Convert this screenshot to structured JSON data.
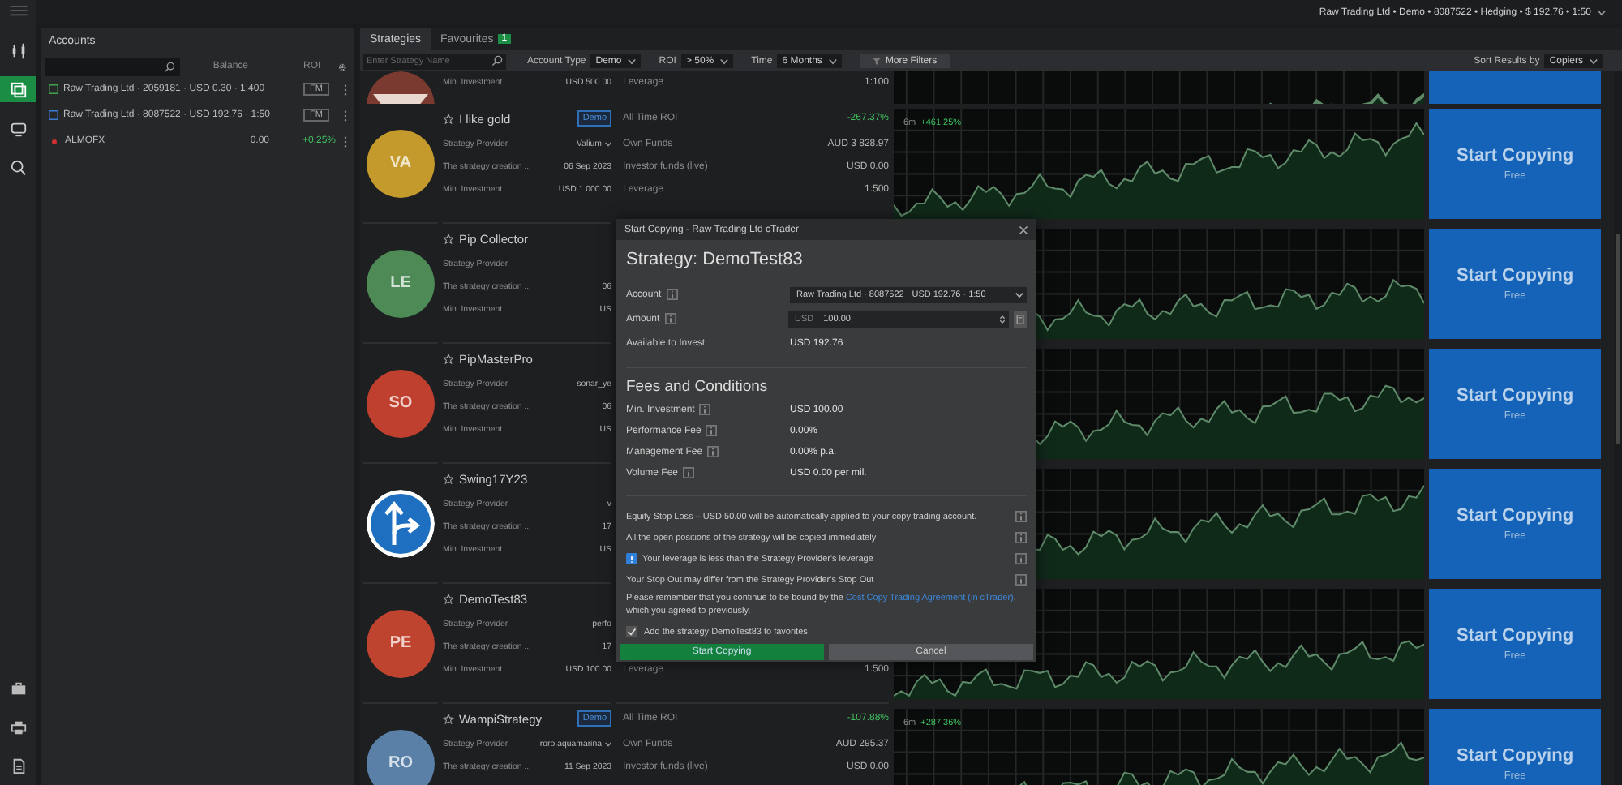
{
  "top_bar": {
    "account": "Raw Trading Ltd • Demo • 8087522 • Hedging • $ 192.76 • 1:50"
  },
  "rail": [
    {
      "kind": "trade",
      "selected": false
    },
    {
      "kind": "copy",
      "selected": true
    },
    {
      "kind": "monitor",
      "selected": false
    },
    {
      "kind": "analyze",
      "selected": false
    }
  ],
  "rail_bottom": [
    {
      "kind": "briefcase",
      "selected": false
    },
    {
      "kind": "printer",
      "selected": false
    },
    {
      "kind": "document",
      "selected": false
    }
  ],
  "accounts": {
    "title": "Accounts",
    "columns": [
      "Balance",
      "ROI"
    ],
    "rows": [
      {
        "kind": "ctrader",
        "color": "#3fa34d",
        "label": "Raw Trading Ltd · 2059181 · USD 0.30 · 1:400",
        "badge": "FM"
      },
      {
        "kind": "ctrader",
        "color": "#3a7bd5",
        "label": "Raw Trading Ltd · 8087522 · USD 192.76 · 1:50",
        "badge": "FM"
      },
      {
        "kind": "broker",
        "color": "#d03030",
        "label": "ALMOFX",
        "balance": "0.00",
        "roi": "+0.25%"
      }
    ]
  },
  "tabs": [
    {
      "label": "Strategies",
      "selected": true
    },
    {
      "label": "Favourites",
      "count": "1",
      "selected": false
    }
  ],
  "filters": {
    "search_placeholder": "Enter Strategy Name",
    "selects": [
      {
        "label": "Account Type",
        "value": "Demo"
      },
      {
        "label": "ROI",
        "value": "> 50%"
      },
      {
        "label": "Time",
        "value": "6 Months"
      }
    ],
    "more": "More Filters",
    "sort": {
      "label": "Sort Results by",
      "value": "Copiers"
    }
  },
  "strategies": [
    {
      "kind": "partial",
      "avatar": {
        "kind": "picture"
      },
      "min_label": "Min. Investment",
      "min": "USD 500.00",
      "stats": [
        {
          "kind": "leverage",
          "label": "Leverage",
          "value": "1:100"
        }
      ]
    },
    {
      "kind": "full",
      "name": "I like gold",
      "demo": "Demo",
      "avatar": {
        "kind": "initials",
        "initials": "VA",
        "color": "#c49a2c"
      },
      "provider_label": "Strategy Provider",
      "provider": "Valium",
      "created_label": "The strategy creation ...",
      "created": "06 Sep 2023",
      "min_label": "Min. Investment",
      "min": "USD 1 000.00",
      "stats": [
        {
          "kind": "roi",
          "label": "All Time ROI",
          "value": "-267.37%"
        },
        {
          "kind": "funds",
          "label": "Own Funds",
          "value": "AUD 3 828.97"
        },
        {
          "kind": "investor",
          "label": "Investor funds (live)",
          "value": "USD 0.00"
        },
        {
          "kind": "leverage",
          "label": "Leverage",
          "value": "1:500"
        }
      ],
      "chart_label": {
        "period": "6m",
        "value": "+461.25%"
      },
      "button": {
        "label": "Start Copying",
        "sub": "Free"
      }
    },
    {
      "kind": "full",
      "name": "Pip Collector",
      "avatar": {
        "kind": "initials",
        "initials": "LE",
        "color": "#4d8a55"
      },
      "provider_label": "Strategy Provider",
      "created_label": "The strategy creation ...",
      "created": "06",
      "min_label": "Min. Investment",
      "min": "US",
      "button": {
        "label": "Start Copying",
        "sub": "Free"
      }
    },
    {
      "kind": "full",
      "name": "PipMasterPro",
      "avatar": {
        "kind": "initials",
        "initials": "SO",
        "color": "#c0402f"
      },
      "provider_label": "Strategy Provider",
      "provider": "sonar_ye",
      "created_label": "The strategy creation ...",
      "created": "06",
      "min_label": "Min. Investment",
      "min": "US",
      "button": {
        "label": "Start Copying",
        "sub": "Free"
      }
    },
    {
      "kind": "full",
      "name": "Swing17Y23",
      "avatar": {
        "kind": "picture"
      },
      "provider_label": "Strategy Provider",
      "provider": "v",
      "created_label": "The strategy creation ...",
      "created": "17",
      "min_label": "Min. Investment",
      "min": "US",
      "button": {
        "label": "Start Copying",
        "sub": "Free"
      }
    },
    {
      "kind": "full",
      "name": "DemoTest83",
      "avatar": {
        "kind": "initials",
        "initials": "PE",
        "color": "#bf4430"
      },
      "provider_label": "Strategy Provider",
      "provider": "perfo",
      "created_label": "The strategy creation ...",
      "created": "17",
      "min_label": "Min. Investment",
      "min": "USD 100.00",
      "stats": [
        {
          "kind": "leverage",
          "label": "Leverage",
          "value": "1:500"
        }
      ],
      "button": {
        "label": "Start Copying",
        "sub": "Free"
      }
    },
    {
      "kind": "full",
      "name": "WampiStrategy",
      "demo": "Demo",
      "avatar": {
        "kind": "initials",
        "initials": "RO",
        "color": "#5a80a8"
      },
      "provider_label": "Strategy Provider",
      "provider": "roro.aquamarina",
      "created_label": "The strategy creation ...",
      "created": "11 Sep 2023",
      "stats": [
        {
          "kind": "roi",
          "label": "All Time ROI",
          "value": "-107.88%"
        },
        {
          "kind": "funds",
          "label": "Own Funds",
          "value": "AUD 295.37"
        },
        {
          "kind": "investor",
          "label": "Investor funds (live)",
          "value": "USD 0.00"
        }
      ],
      "chart_label": {
        "period": "6m",
        "value": "+287.36%"
      },
      "button": {
        "label": "Start Copying",
        "sub": "Free"
      }
    }
  ],
  "dialog": {
    "title": "Start Copying - Raw Trading Ltd cTrader",
    "heading": "Strategy: DemoTest83",
    "account": {
      "label": "Account",
      "value": "Raw Trading Ltd · 8087522 · USD 192.76 · 1:50"
    },
    "amount": {
      "label": "Amount",
      "currency": "USD",
      "value": "100.00"
    },
    "available": {
      "label": "Available to Invest",
      "value": "USD 192.76"
    },
    "fees_title": "Fees and Conditions",
    "fees": [
      {
        "label": "Min. Investment",
        "value": "USD 100.00"
      },
      {
        "label": "Performance Fee",
        "value": "0.00%"
      },
      {
        "label": "Management Fee",
        "value": "0.00% p.a."
      },
      {
        "label": "Volume Fee",
        "value": "USD 0.00 per mil."
      }
    ],
    "notes": [
      {
        "text": "Equity Stop Loss – USD 50.00 will be automatically applied to your copy trading account.",
        "flagged": false
      },
      {
        "text": "All the open positions of the strategy will be copied immediately",
        "flagged": false
      },
      {
        "text": "Your leverage is less than the Strategy Provider's leverage",
        "flagged": true
      },
      {
        "text": "Your Stop Out may differ from the Strategy Provider's Stop Out",
        "flagged": false
      }
    ],
    "agreement": {
      "before": "Please remember that you continue to be bound by the",
      "link": "Cost Copy Trading Agreement (in cTrader)",
      "after": ", which you agreed to previously."
    },
    "favorite": {
      "label": "Add the strategy DemoTest83 to favorites",
      "checked": true
    },
    "confirm": "Start Copying",
    "cancel": "Cancel"
  }
}
